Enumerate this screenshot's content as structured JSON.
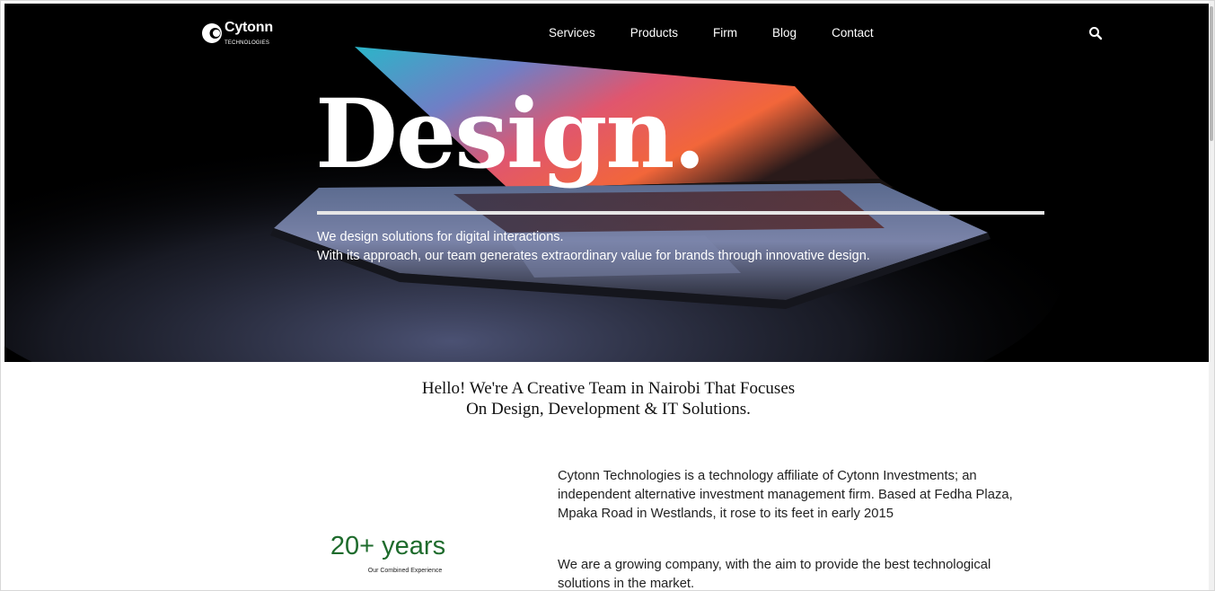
{
  "brand": {
    "name": "Cytonn",
    "sub": "TECHNOLOGIES"
  },
  "nav": {
    "items": [
      {
        "label": "Services"
      },
      {
        "label": "Products"
      },
      {
        "label": "Firm"
      },
      {
        "label": "Blog"
      },
      {
        "label": "Contact"
      }
    ],
    "search_icon": "search-icon"
  },
  "hero": {
    "title": "Design.",
    "line1": "We design solutions for digital interactions.",
    "line2": "With its approach, our team generates extraordinary value for brands through innovative design."
  },
  "intro": {
    "line1": "Hello! We're A Creative Team in Nairobi That Focuses",
    "line2": "On Design, Development & IT Solutions."
  },
  "stat": {
    "value": "20+ years",
    "caption": "Our Combined Experience"
  },
  "about": {
    "paragraph1": "Cytonn Technologies is a technology affiliate of Cytonn Investments; an independent alternative investment management firm. Based at Fedha Plaza, Mpaka Road in Westlands, it rose to its feet in early 2015",
    "paragraph2": "We are a growing company, with the aim to provide the best technological solutions in the market."
  },
  "colors": {
    "accent_green": "#1e6b2c",
    "hero_bg": "#000000"
  }
}
